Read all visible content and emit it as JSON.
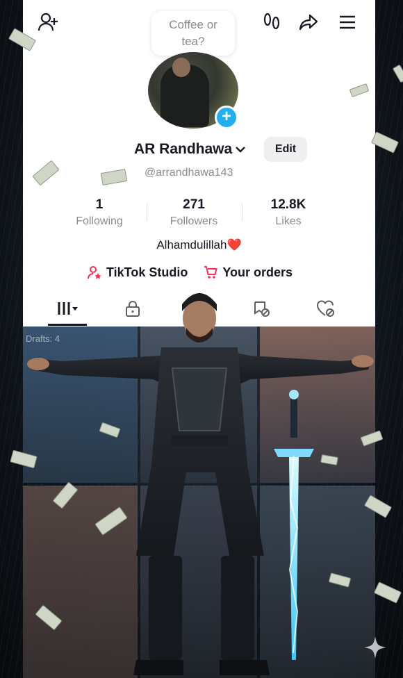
{
  "note_bubble": {
    "line1": "Coffee or",
    "line2": "tea?"
  },
  "profile": {
    "name": "AR Randhawa",
    "handle": "@arrandhawa143",
    "edit_label": "Edit",
    "bio_text": "Alhamdulillah",
    "bio_emoji": "❤️"
  },
  "stats": [
    {
      "value": "1",
      "label": "Following"
    },
    {
      "value": "271",
      "label": "Followers"
    },
    {
      "value": "12.8K",
      "label": "Likes"
    }
  ],
  "links": [
    {
      "label": "TikTok Studio",
      "icon": "studio-person-icon"
    },
    {
      "label": "Your orders",
      "icon": "cart-icon"
    }
  ],
  "header_icons": [
    "add-friend-icon",
    "footprints-icon",
    "share-icon",
    "menu-icon"
  ],
  "tabs": [
    "videos-grid-icon",
    "lock-icon",
    "reposts-icon",
    "liked-icon"
  ],
  "grid": {
    "drafts_label": "Drafts: 4"
  },
  "colors": {
    "accent_blue": "#20b0f0",
    "text": "#161823",
    "muted": "#8a8b91",
    "studio_pink": "#fe2c55"
  }
}
